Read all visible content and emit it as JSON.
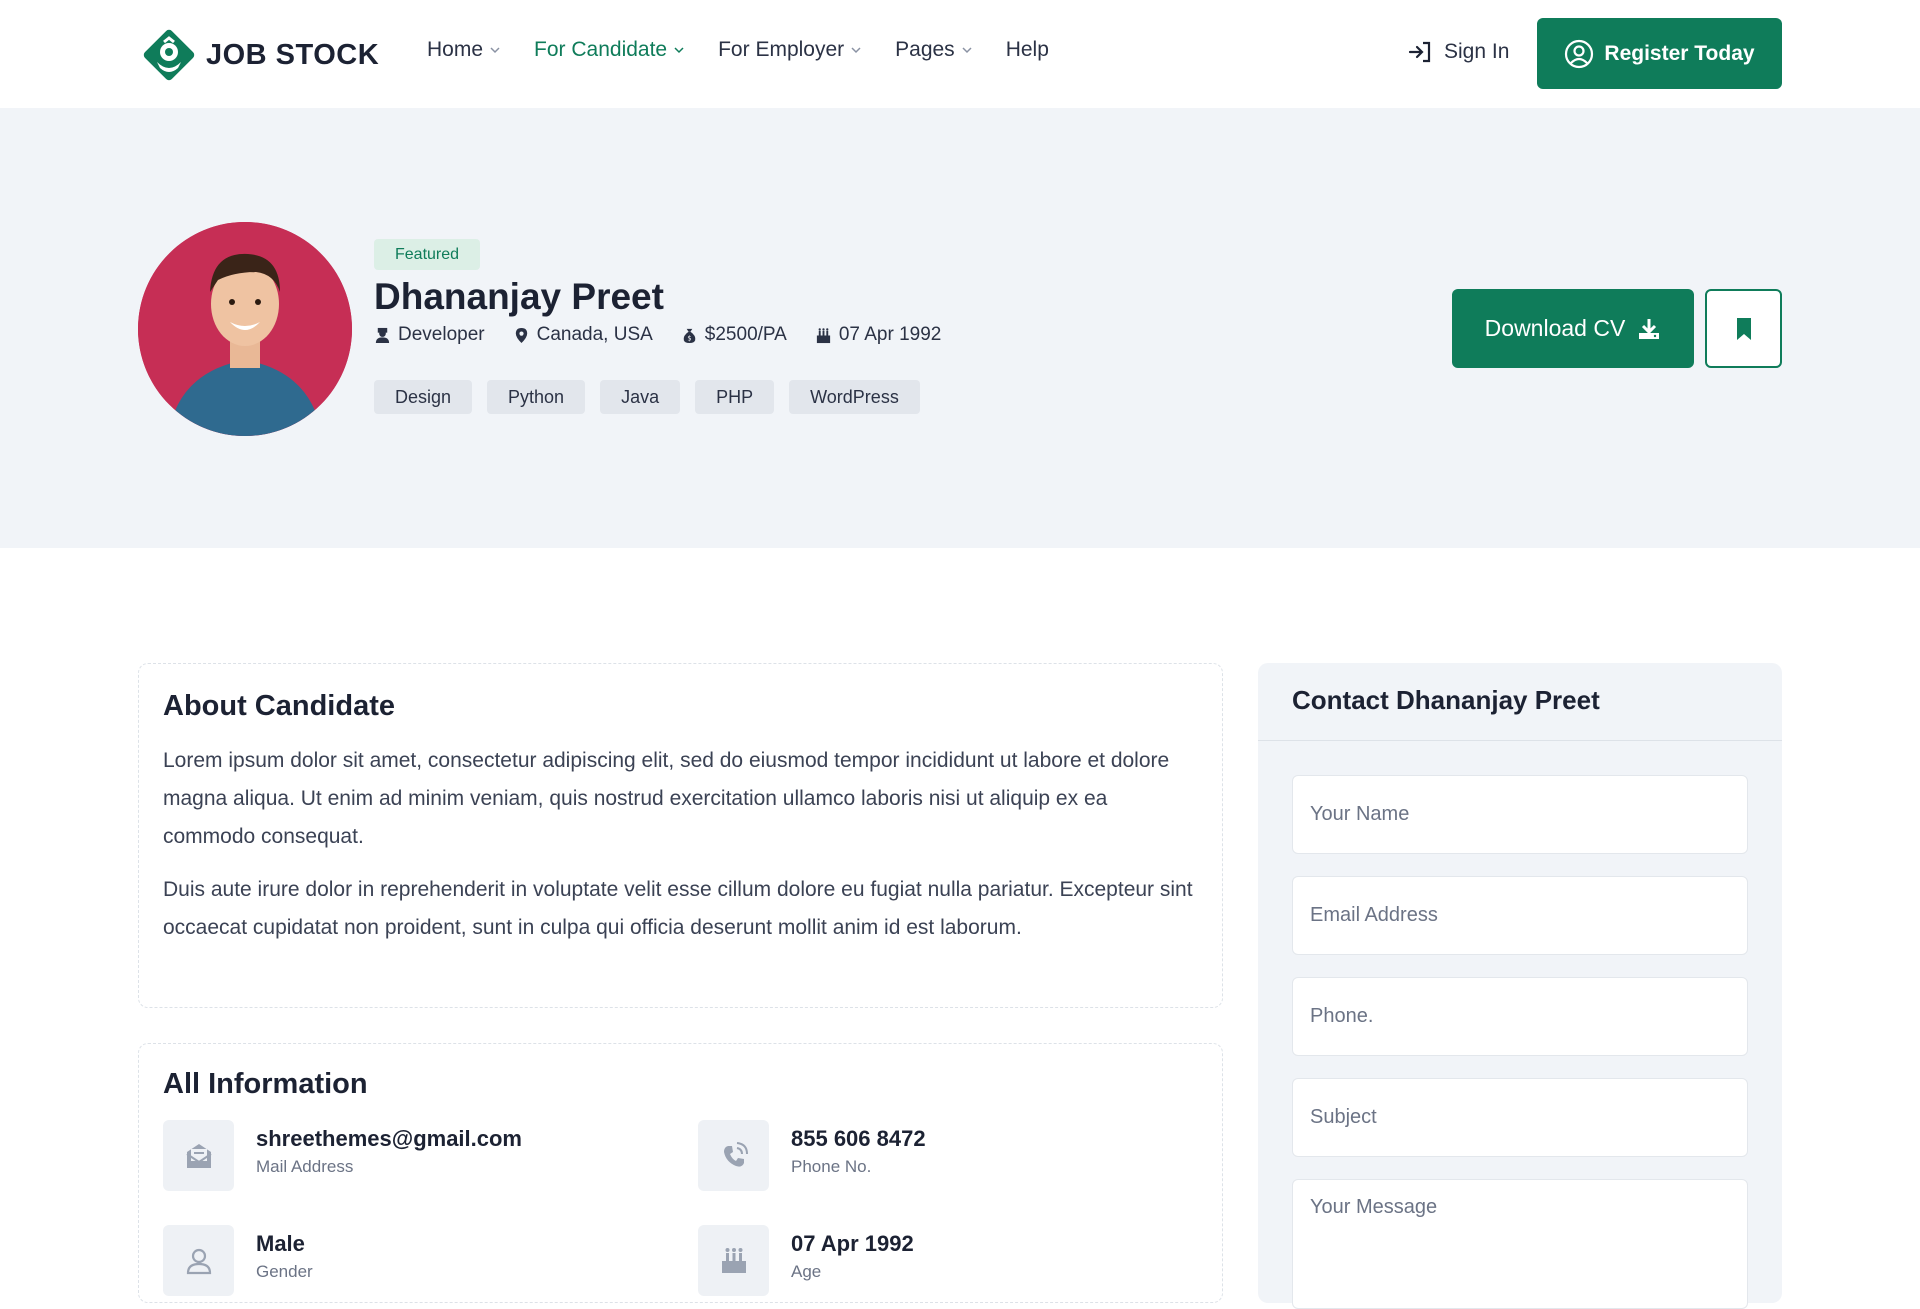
{
  "brand": {
    "name": "JOB STOCK",
    "accent": "#0f7c5a"
  },
  "nav": {
    "items": [
      {
        "label": "Home",
        "has_dropdown": true,
        "active": false
      },
      {
        "label": "For Candidate",
        "has_dropdown": true,
        "active": true
      },
      {
        "label": "For Employer",
        "has_dropdown": true,
        "active": false
      },
      {
        "label": "Pages",
        "has_dropdown": true,
        "active": false
      },
      {
        "label": "Help",
        "has_dropdown": false,
        "active": false
      }
    ],
    "signin_label": "Sign In",
    "register_label": "Register Today"
  },
  "candidate": {
    "badge": "Featured",
    "name": "Dhananjay Preet",
    "meta": {
      "role": "Developer",
      "location": "Canada, USA",
      "salary": "$2500/PA",
      "dob": "07 Apr 1992"
    },
    "skills": [
      "Design",
      "Python",
      "Java",
      "PHP",
      "WordPress"
    ],
    "download_label": "Download CV"
  },
  "about": {
    "title": "About Candidate",
    "paragraphs": [
      "Lorem ipsum dolor sit amet, consectetur adipiscing elit, sed do eiusmod tempor incididunt ut labore et dolore magna aliqua. Ut enim ad minim veniam, quis nostrud exercitation ullamco laboris nisi ut aliquip ex ea commodo consequat.",
      "Duis aute irure dolor in reprehenderit in voluptate velit esse cillum dolore eu fugiat nulla pariatur. Excepteur sint occaecat cupidatat non proident, sunt in culpa qui officia deserunt mollit anim id est laborum."
    ]
  },
  "all_info": {
    "title": "All Information",
    "items": [
      {
        "value": "shreethemes@gmail.com",
        "label": "Mail Address",
        "icon": "mail-icon"
      },
      {
        "value": "855 606 8472",
        "label": "Phone No.",
        "icon": "phone-icon"
      },
      {
        "value": "Male",
        "label": "Gender",
        "icon": "user-icon"
      },
      {
        "value": "07 Apr 1992",
        "label": "Age",
        "icon": "cake-icon"
      }
    ]
  },
  "contact": {
    "title": "Contact Dhananjay Preet",
    "placeholders": {
      "name": "Your Name",
      "email": "Email Address",
      "phone": "Phone.",
      "subject": "Subject",
      "message": "Your Message"
    }
  }
}
